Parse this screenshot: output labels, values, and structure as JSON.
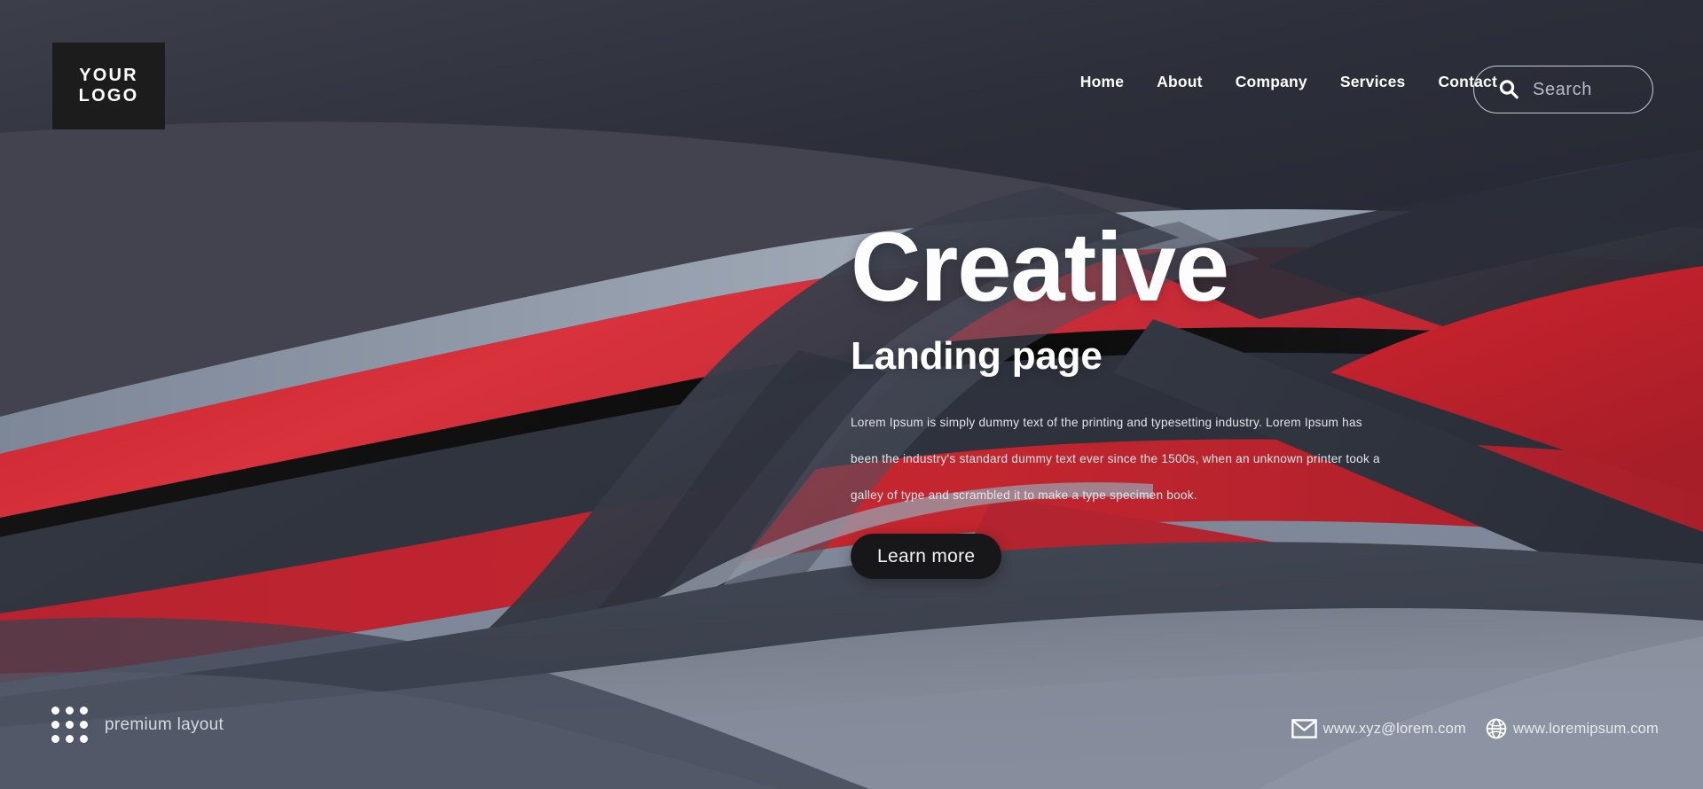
{
  "page": {
    "background_color": "#43434f",
    "accent_red": "#bd2733",
    "dark_slate": "#2e323c",
    "light_gray_blue": "#9aa3b0",
    "bottom_gray": "#7b8393"
  },
  "header": {
    "logo": {
      "line1": "YOUR",
      "line2": "LOGO",
      "background": "#1c1c1c"
    },
    "nav_items": [
      {
        "label": "Home"
      },
      {
        "label": "About"
      },
      {
        "label": "Company"
      },
      {
        "label": "Services"
      },
      {
        "label": "Contact"
      }
    ],
    "search": {
      "placeholder": "Search",
      "icon": "search-icon"
    }
  },
  "hero": {
    "title": "Creative",
    "subtitle": "Landing page",
    "paragraph_lines": [
      "Lorem Ipsum is simply dummy text of the printing and typesetting industry. Lorem Ipsum has",
      "been the industry's standard dummy text ever since the 1500s, when an unknown printer took a",
      "galley of type and scrambled it to make a type specimen book."
    ],
    "cta_label": "Learn more"
  },
  "footer": {
    "tagline": "premium layout",
    "grid_icon": "dot-grid-icon",
    "contacts": [
      {
        "icon": "envelope-icon",
        "text": "www.xyz@lorem.com"
      },
      {
        "icon": "globe-icon",
        "text": "www.loremipsum.com"
      }
    ]
  }
}
